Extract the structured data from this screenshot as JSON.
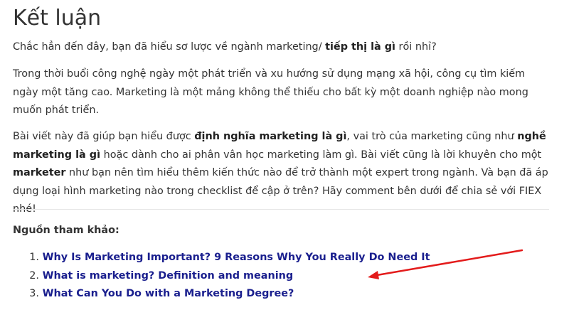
{
  "article": {
    "heading": "Kết luận",
    "p1": {
      "text_before": "Chắc hẳn đến đây, bạn đã hiểu sơ lược về ngành marketing/ ",
      "bold": "tiếp thị là gì",
      "text_after": " rồi nhỉ?"
    },
    "p2": "Trong thời buổi công nghệ ngày một phát triển và xu hướng sử dụng mạng xã hội, công cụ tìm kiếm ngày một tăng cao. Marketing là một mảng không thể thiếu cho bất kỳ một doanh nghiệp nào mong muốn phát triển.",
    "p3": {
      "t1": "Bài viết này đã giúp bạn hiểu được ",
      "b1": "định nghĩa marketing là gì",
      "t2": ", vai trò của marketing cũng như ",
      "b2": "nghề marketing là gì",
      "t3": " hoặc dành cho ai phân vân học marketing làm gì. Bài viết cũng là lời khuyên cho một ",
      "b3": "marketer",
      "t4": " như bạn nên tìm hiểu thêm kiến thức nào để trở thành một expert trong ngành. Và bạn đã áp dụng loại hình marketing nào trong checklist để cập ở trên? Hãy comment bên dưới để chia sẻ với FIEX nhé!"
    },
    "sources_label": "Nguồn tham khảo:",
    "references": [
      {
        "num": "1.",
        "title": "Why Is Marketing Important? 9 Reasons Why You Really Do Need It"
      },
      {
        "num": "2.",
        "title": "What is marketing? Definition and meaning"
      },
      {
        "num": "3.",
        "title": "What Can You Do with a Marketing Degree?"
      }
    ]
  },
  "annotation": {
    "arrow_color": "#e31b1b"
  }
}
